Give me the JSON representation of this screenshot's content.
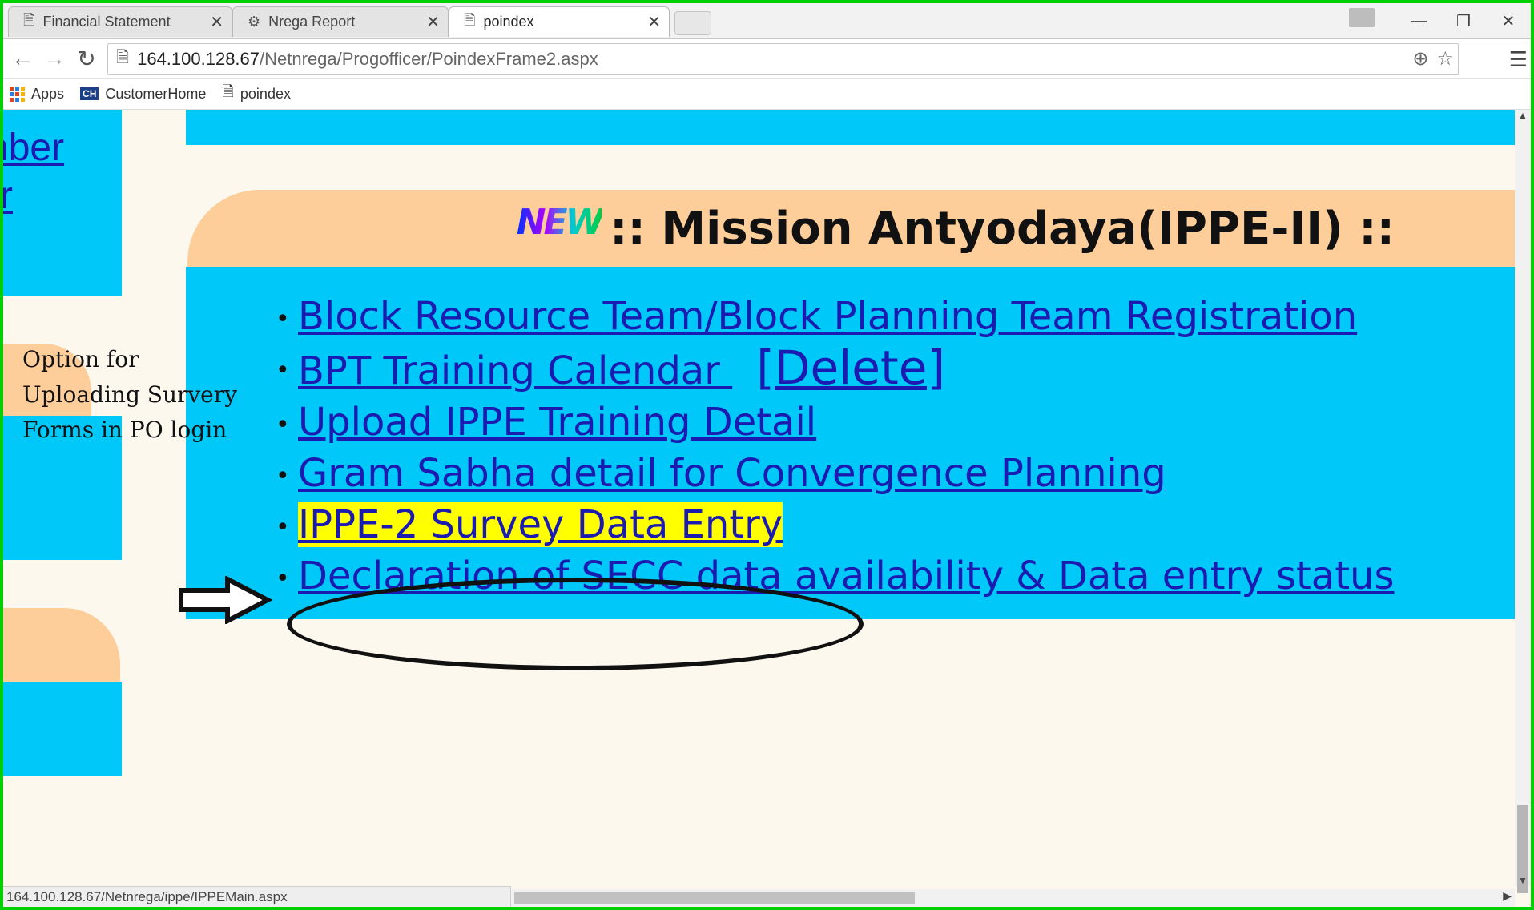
{
  "browser": {
    "tabs": [
      {
        "label": "Financial Statement",
        "active": false
      },
      {
        "label": "Nrega Report",
        "active": false
      },
      {
        "label": "poindex",
        "active": true
      }
    ],
    "address": {
      "host": "164.100.128.67",
      "path": "/Netnrega/Progofficer/PoindexFrame2.aspx"
    },
    "bookmarks": [
      "Apps",
      "CustomerHome",
      "poindex"
    ]
  },
  "left_panel": {
    "link_fragment_1": "nber",
    "link_fragment_2": "r"
  },
  "annotation": {
    "line1": "Option for",
    "line2": "Uploading Survery",
    "line3": "Forms in PO login"
  },
  "section": {
    "badge": "NEW",
    "title": ":: Mission Antyodaya(IPPE-II) ::",
    "links": [
      "Block Resource Team/Block Planning Team Registration ",
      "BPT Training Calendar ",
      "Upload IPPE Training Detail ",
      "Gram Sabha detail for Convergence Planning ",
      "IPPE-2 Survey Data Entry ",
      "Declaration of SECC data availability & Data entry status "
    ],
    "delete_label": "[Delete]",
    "highlighted_index": 4
  },
  "status": {
    "url": "164.100.128.67/Netnrega/ippe/IPPEMain.aspx"
  },
  "colors": {
    "panel_blue": "#00c8f8",
    "peach": "#fdcd9a",
    "link": "#1b1bb2",
    "highlight": "#ffff00",
    "frame_green": "#00d000"
  }
}
